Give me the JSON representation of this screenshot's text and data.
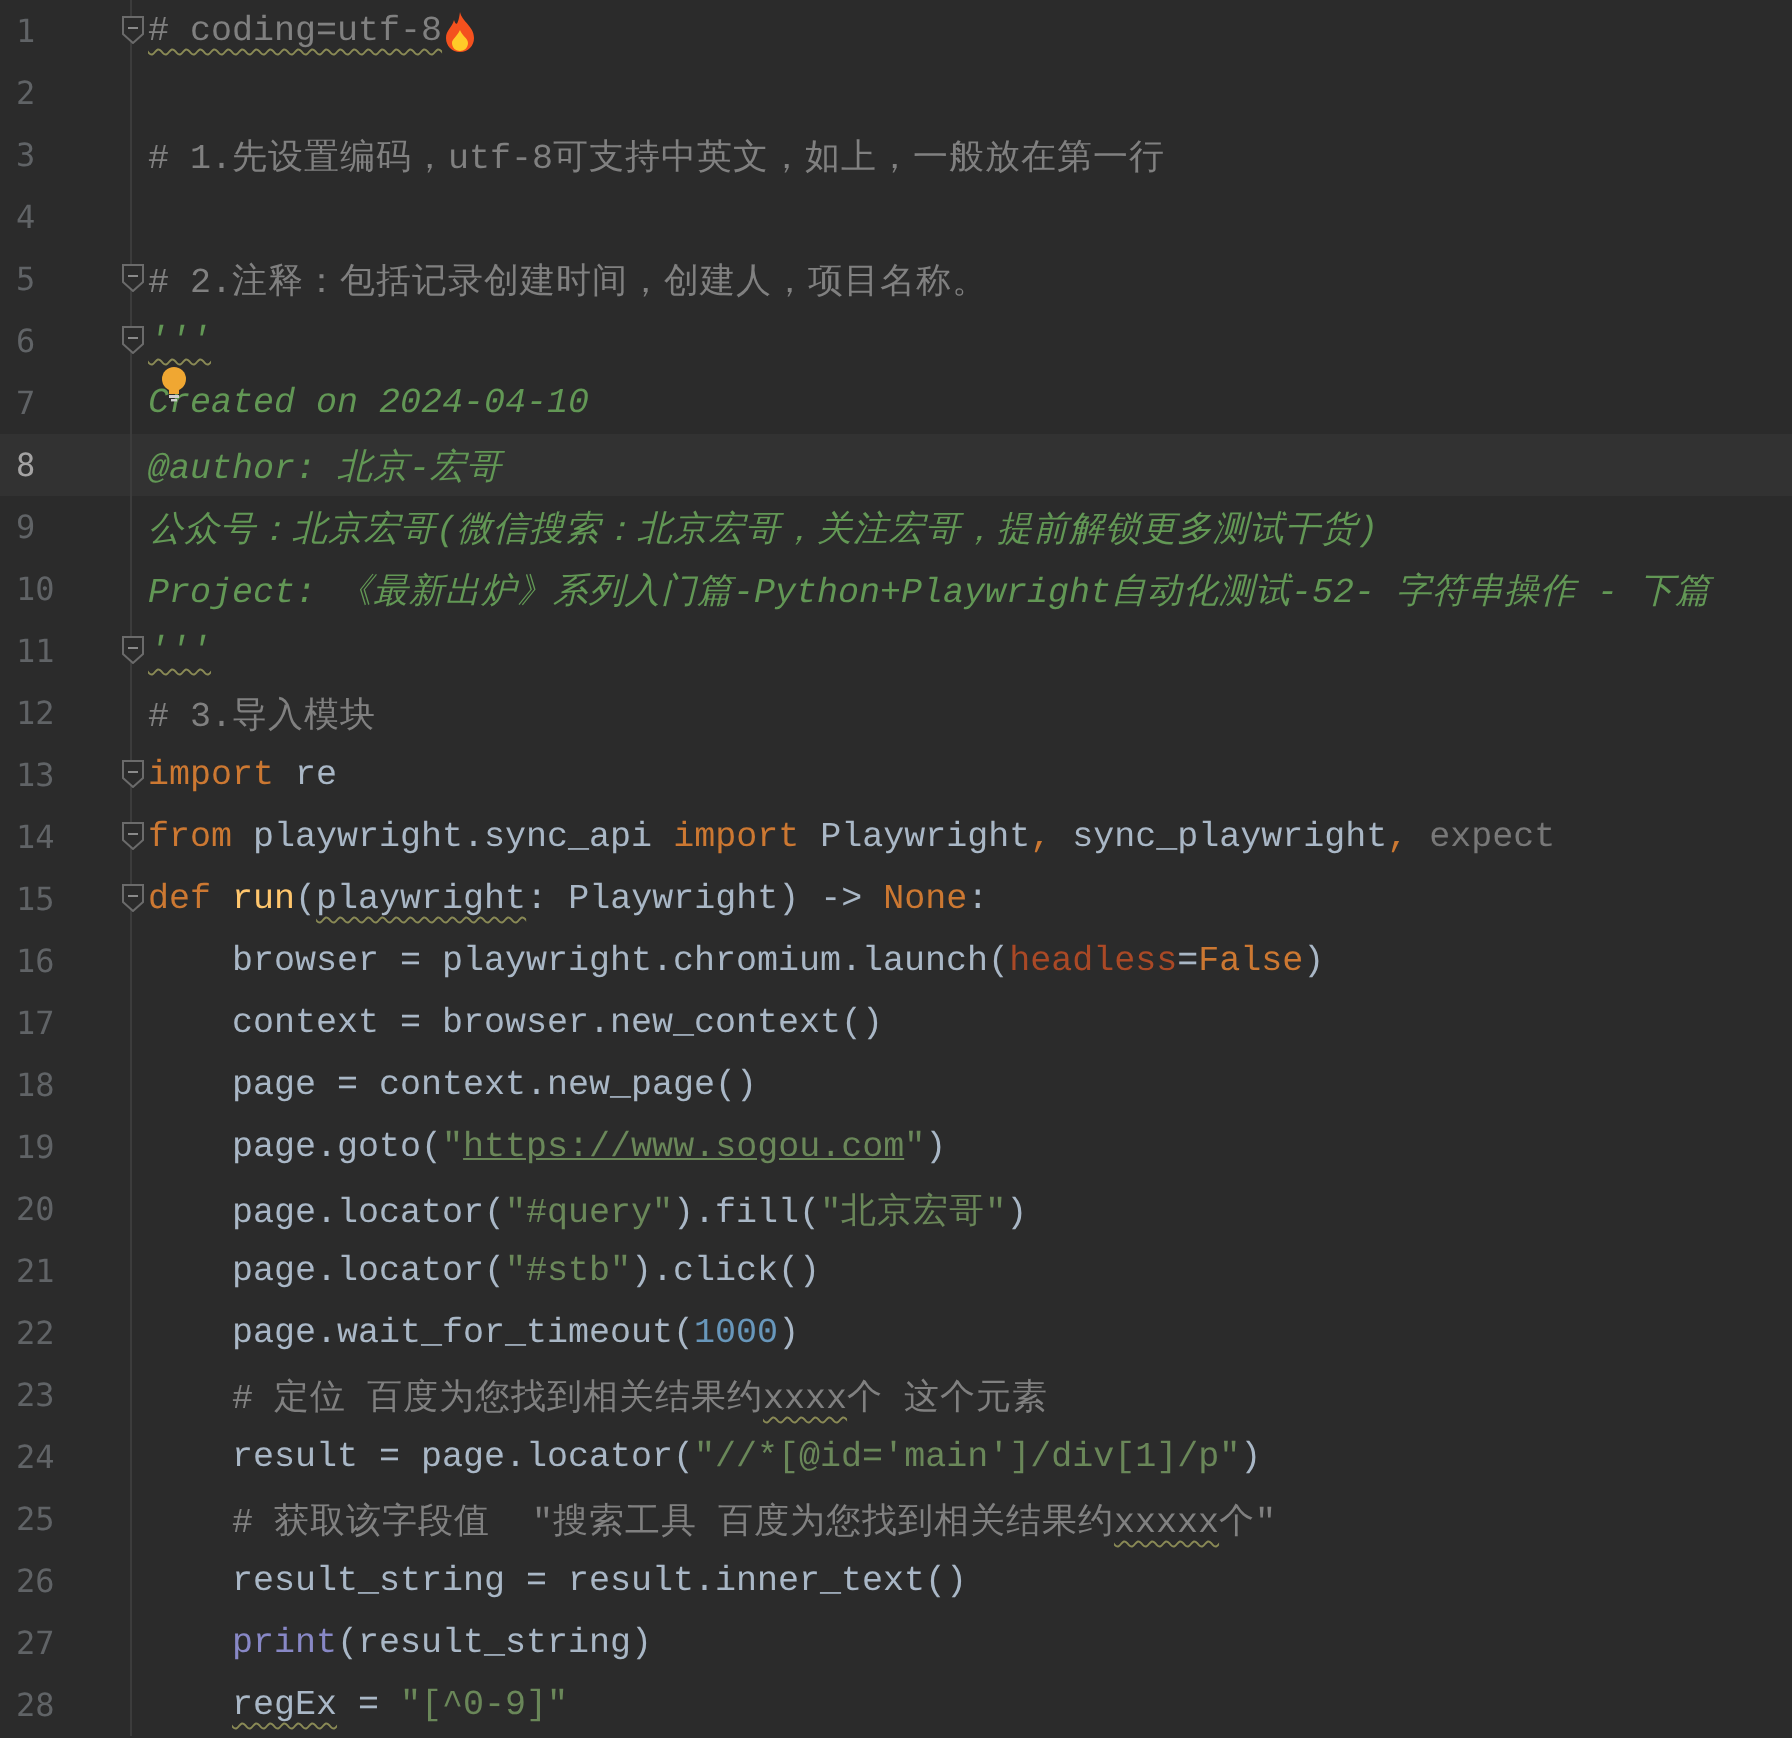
{
  "editor": {
    "lines": [
      {
        "number": "1",
        "fold": true,
        "selected": false,
        "tokens": [
          {
            "kind": "comment",
            "text": "# coding=utf-8",
            "squiggle": true
          }
        ]
      },
      {
        "number": "2",
        "fold": false,
        "selected": false
      },
      {
        "number": "3",
        "fold": false,
        "selected": false,
        "tokens": [
          {
            "kind": "comment",
            "text": "# 1.先设置编码，utf-8可支持中英文，如上，一般放在第一行"
          }
        ]
      },
      {
        "number": "4",
        "fold": false,
        "selected": false
      },
      {
        "number": "5",
        "fold": true,
        "selected": false,
        "tokens": [
          {
            "kind": "comment",
            "text": "# 2.注释：包括记录创建时间，创建人，项目名称。"
          }
        ]
      },
      {
        "number": "6",
        "fold": true,
        "selected": false,
        "tokens": [
          {
            "kind": "doc",
            "text": "'''",
            "squiggle": true
          }
        ]
      },
      {
        "number": "7",
        "fold": false,
        "selected": false,
        "tokens": [
          {
            "kind": "doc",
            "text": "Created on 2024-04-10"
          }
        ]
      },
      {
        "number": "8",
        "fold": false,
        "selected": true,
        "tokens": [
          {
            "kind": "doc",
            "text": "@author: 北京-宏哥"
          }
        ]
      },
      {
        "number": "9",
        "fold": false,
        "selected": false,
        "tokens": [
          {
            "kind": "doc",
            "text": "公众号：北京宏哥(微信搜索：北京宏哥，关注宏哥，提前解锁更多测试干货)"
          }
        ]
      },
      {
        "number": "10",
        "fold": false,
        "selected": false,
        "tokens": [
          {
            "kind": "doc",
            "text": "Project: 《最新出炉》系列入门篇-Python+Playwright自动化测试-52- 字符串操作 - 下篇"
          }
        ]
      },
      {
        "number": "11",
        "fold": true,
        "selected": false,
        "tokens": [
          {
            "kind": "doc",
            "text": "'''",
            "squiggle": true
          }
        ]
      },
      {
        "number": "12",
        "fold": false,
        "selected": false,
        "tokens": [
          {
            "kind": "comment",
            "text": "# 3.导入模块"
          }
        ]
      },
      {
        "number": "13",
        "fold": true,
        "selected": false,
        "tokens": [
          {
            "kind": "keyword",
            "text": "import"
          },
          {
            "kind": "plain",
            "text": " re"
          }
        ]
      },
      {
        "number": "14",
        "fold": true,
        "selected": false,
        "tokens": [
          {
            "kind": "keyword",
            "text": "from"
          },
          {
            "kind": "plain",
            "text": " playwright.sync_api "
          },
          {
            "kind": "keyword",
            "text": "import"
          },
          {
            "kind": "plain",
            "text": " Playwright"
          },
          {
            "kind": "keyword",
            "text": ","
          },
          {
            "kind": "plain",
            "text": " sync_playwright"
          },
          {
            "kind": "keyword",
            "text": ","
          },
          {
            "kind": "dim",
            "text": " expect"
          }
        ]
      },
      {
        "number": "15",
        "fold": true,
        "selected": false,
        "tokens": [
          {
            "kind": "keyword",
            "text": "def "
          },
          {
            "kind": "func",
            "text": "run"
          },
          {
            "kind": "plain",
            "text": "("
          },
          {
            "kind": "plain",
            "text": "playwright",
            "squiggle": true
          },
          {
            "kind": "plain",
            "text": ": Playwright) -> "
          },
          {
            "kind": "keyword",
            "text": "None"
          },
          {
            "kind": "plain",
            "text": ":"
          }
        ]
      },
      {
        "number": "16",
        "fold": false,
        "selected": false,
        "indented": true,
        "tokens": [
          {
            "kind": "plain",
            "text": "browser = playwright.chromium.launch("
          },
          {
            "kind": "param",
            "text": "headless"
          },
          {
            "kind": "plain",
            "text": "="
          },
          {
            "kind": "keyword",
            "text": "False"
          },
          {
            "kind": "plain",
            "text": ")"
          }
        ]
      },
      {
        "number": "17",
        "fold": false,
        "selected": false,
        "indented": true,
        "tokens": [
          {
            "kind": "plain",
            "text": "context = browser.new_context()"
          }
        ]
      },
      {
        "number": "18",
        "fold": false,
        "selected": false,
        "indented": true,
        "tokens": [
          {
            "kind": "plain",
            "text": "page = context.new_page()"
          }
        ]
      },
      {
        "number": "19",
        "fold": false,
        "selected": false,
        "indented": true,
        "tokens": [
          {
            "kind": "plain",
            "text": "page.goto("
          },
          {
            "kind": "string",
            "text": "\""
          },
          {
            "kind": "url",
            "text": "https://www.sogou.com"
          },
          {
            "kind": "string",
            "text": "\""
          },
          {
            "kind": "plain",
            "text": ")"
          }
        ]
      },
      {
        "number": "20",
        "fold": false,
        "selected": false,
        "indented": true,
        "tokens": [
          {
            "kind": "plain",
            "text": "page.locator("
          },
          {
            "kind": "string",
            "text": "\"#query\""
          },
          {
            "kind": "plain",
            "text": ").fill("
          },
          {
            "kind": "string",
            "text": "\"北京宏哥\""
          },
          {
            "kind": "plain",
            "text": ")"
          }
        ]
      },
      {
        "number": "21",
        "fold": false,
        "selected": false,
        "indented": true,
        "tokens": [
          {
            "kind": "plain",
            "text": "page.locator("
          },
          {
            "kind": "string",
            "text": "\"#stb\""
          },
          {
            "kind": "plain",
            "text": ").click()"
          }
        ]
      },
      {
        "number": "22",
        "fold": false,
        "selected": false,
        "indented": true,
        "tokens": [
          {
            "kind": "plain",
            "text": "page.wait_for_timeout("
          },
          {
            "kind": "number",
            "text": "1000"
          },
          {
            "kind": "plain",
            "text": ")"
          }
        ]
      },
      {
        "number": "23",
        "fold": false,
        "selected": false,
        "indented": true,
        "tokens": [
          {
            "kind": "comment",
            "text": "# 定位 百度为您找到相关结果约"
          },
          {
            "kind": "comment",
            "text": "xxxx",
            "squiggle": true
          },
          {
            "kind": "comment",
            "text": "个 这个元素"
          }
        ]
      },
      {
        "number": "24",
        "fold": false,
        "selected": false,
        "indented": true,
        "tokens": [
          {
            "kind": "plain",
            "text": "result = page.locator("
          },
          {
            "kind": "string",
            "text": "\"//*[@id='main']/div[1]/p\""
          },
          {
            "kind": "plain",
            "text": ")"
          }
        ]
      },
      {
        "number": "25",
        "fold": false,
        "selected": false,
        "indented": true,
        "tokens": [
          {
            "kind": "comment",
            "text": "# 获取该字段值  \"搜索工具 百度为您找到相关结果约"
          },
          {
            "kind": "comment",
            "text": "xxxxx",
            "squiggle": true
          },
          {
            "kind": "comment",
            "text": "个\""
          }
        ]
      },
      {
        "number": "26",
        "fold": false,
        "selected": false,
        "indented": true,
        "tokens": [
          {
            "kind": "plain",
            "text": "result_string = result.inner_text()"
          }
        ]
      },
      {
        "number": "27",
        "fold": false,
        "selected": false,
        "indented": true,
        "tokens": [
          {
            "kind": "builtin",
            "text": "print"
          },
          {
            "kind": "plain",
            "text": "(result_string)"
          }
        ]
      },
      {
        "number": "28",
        "fold": false,
        "selected": false,
        "indented": true,
        "tokens": [
          {
            "kind": "plain",
            "text": "regEx",
            "squiggle": true
          },
          {
            "kind": "plain",
            "text": " = "
          },
          {
            "kind": "string",
            "text": "\"[^0-9]\""
          }
        ]
      }
    ]
  }
}
